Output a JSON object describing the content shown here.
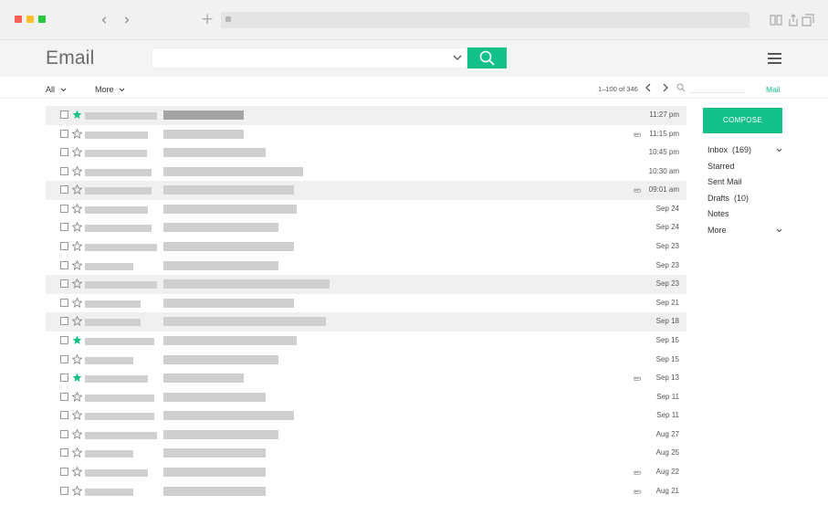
{
  "app": {
    "logo": "Email",
    "search": {
      "value": "",
      "placeholder": ""
    },
    "toolbar": {
      "all_label": "All",
      "more_label": "More",
      "pagination": "1–100 of 346",
      "mail_link": "Mail"
    },
    "compose_label": "COMPOSE",
    "sidebar": [
      {
        "label": "Inbox  (169)",
        "expand": true
      },
      {
        "label": "Starred",
        "expand": false
      },
      {
        "label": "Sent Mail",
        "expand": false
      },
      {
        "label": "Drafts  (10)",
        "expand": false
      },
      {
        "label": "Notes",
        "expand": false
      },
      {
        "label": "More",
        "expand": true
      }
    ]
  },
  "colors": {
    "accent": "#14c08a",
    "highlight_row": "#f0f0f0"
  },
  "emails": [
    {
      "date": "11:27 pm",
      "starred": true,
      "attachment": false,
      "highlighted": true,
      "unread": true
    },
    {
      "date": "11:15 pm",
      "starred": false,
      "attachment": true,
      "highlighted": false,
      "unread": false
    },
    {
      "date": "10:45 pm",
      "starred": false,
      "attachment": false,
      "highlighted": false,
      "unread": false
    },
    {
      "date": "10:30 am",
      "starred": false,
      "attachment": false,
      "highlighted": false,
      "unread": false
    },
    {
      "date": "09:01 am",
      "starred": false,
      "attachment": true,
      "highlighted": true,
      "unread": false
    },
    {
      "date": "Sep 24",
      "starred": false,
      "attachment": false,
      "highlighted": false,
      "unread": false
    },
    {
      "date": "Sep 24",
      "starred": false,
      "attachment": false,
      "highlighted": false,
      "unread": false
    },
    {
      "date": "Sep 23",
      "starred": false,
      "attachment": false,
      "highlighted": false,
      "unread": false
    },
    {
      "date": "Sep 23",
      "starred": false,
      "attachment": false,
      "highlighted": false,
      "unread": false
    },
    {
      "date": "Sep 23",
      "starred": false,
      "attachment": false,
      "highlighted": true,
      "unread": false
    },
    {
      "date": "Sep 21",
      "starred": false,
      "attachment": false,
      "highlighted": false,
      "unread": false
    },
    {
      "date": "Sep 18",
      "starred": false,
      "attachment": false,
      "highlighted": true,
      "unread": false
    },
    {
      "date": "Sep 15",
      "starred": true,
      "attachment": false,
      "highlighted": false,
      "unread": false
    },
    {
      "date": "Sep 15",
      "starred": false,
      "attachment": false,
      "highlighted": false,
      "unread": false
    },
    {
      "date": "Sep 13",
      "starred": true,
      "attachment": true,
      "highlighted": false,
      "unread": false
    },
    {
      "date": "Sep 11",
      "starred": false,
      "attachment": false,
      "highlighted": false,
      "unread": false
    },
    {
      "date": "Sep 11",
      "starred": false,
      "attachment": false,
      "highlighted": false,
      "unread": false
    },
    {
      "date": "Aug 27",
      "starred": false,
      "attachment": false,
      "highlighted": false,
      "unread": false
    },
    {
      "date": "Aug 25",
      "starred": false,
      "attachment": false,
      "highlighted": false,
      "unread": false
    },
    {
      "date": "Aug 22",
      "starred": false,
      "attachment": true,
      "highlighted": false,
      "unread": false
    },
    {
      "date": "Aug 21",
      "starred": false,
      "attachment": true,
      "highlighted": false,
      "unread": false
    }
  ]
}
